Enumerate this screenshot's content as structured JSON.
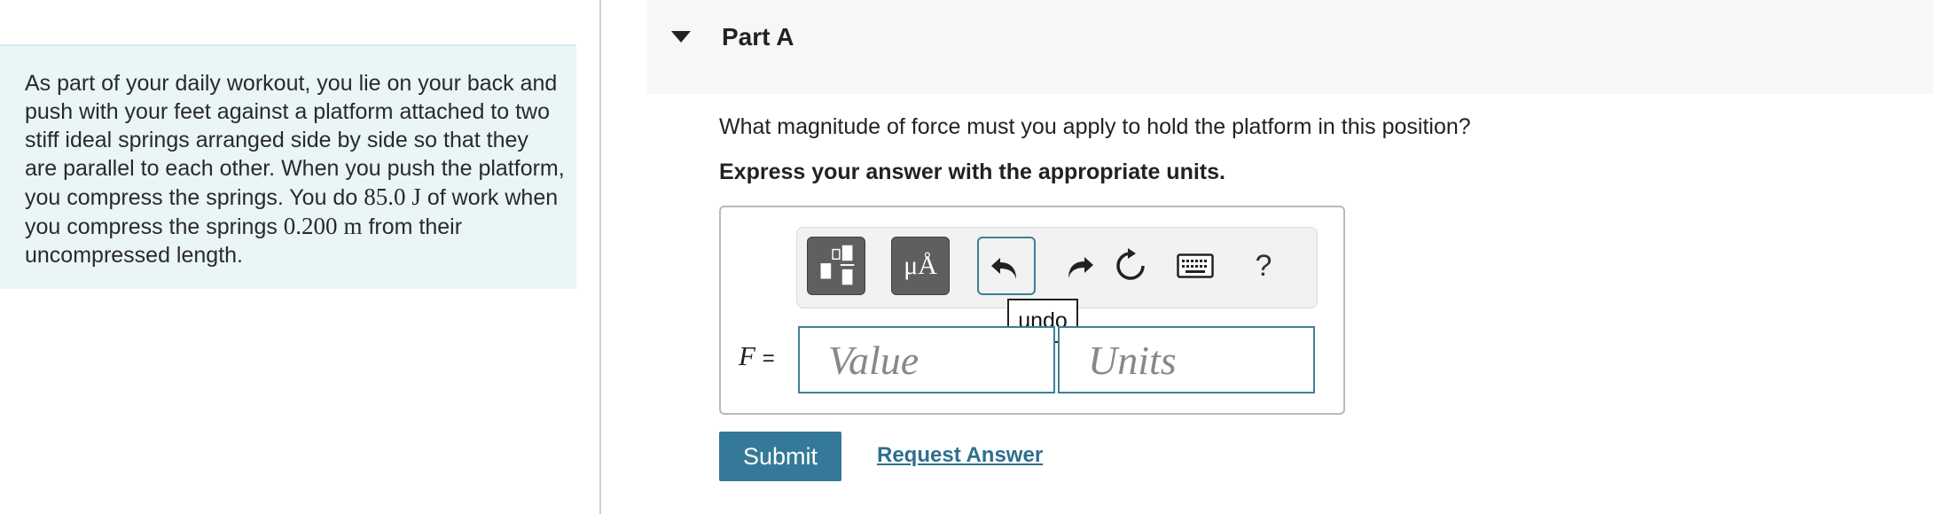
{
  "problem": {
    "text_1": "As part of your daily workout, you lie on your back and push with your feet against a platform attached to two stiff ideal springs arranged side by side so that they are parallel to each other. When you push the platform, you compress the springs. You do ",
    "work_value": "85.0",
    "work_unit": "J",
    "text_2": " of work when you compress the springs ",
    "distance_value": "0.200",
    "distance_unit": "m",
    "text_3": " from their uncompressed length."
  },
  "part": {
    "title": "Part A",
    "question": "What magnitude of force must you apply to hold the platform in this position?",
    "instruction": "Express your answer with the appropriate units."
  },
  "toolbar": {
    "templates_icon": "fraction-template-icon",
    "units_label": "μÅ",
    "undo_icon": "undo-arrow-icon",
    "redo_icon": "redo-arrow-icon",
    "reset_icon": "reset-icon",
    "keyboard_icon": "keyboard-icon",
    "help_label": "?",
    "tooltip": "undo"
  },
  "answer": {
    "variable": "F",
    "equals": "=",
    "value_placeholder": "Value",
    "units_placeholder": "Units"
  },
  "actions": {
    "submit_label": "Submit",
    "request_answer_label": "Request Answer"
  }
}
